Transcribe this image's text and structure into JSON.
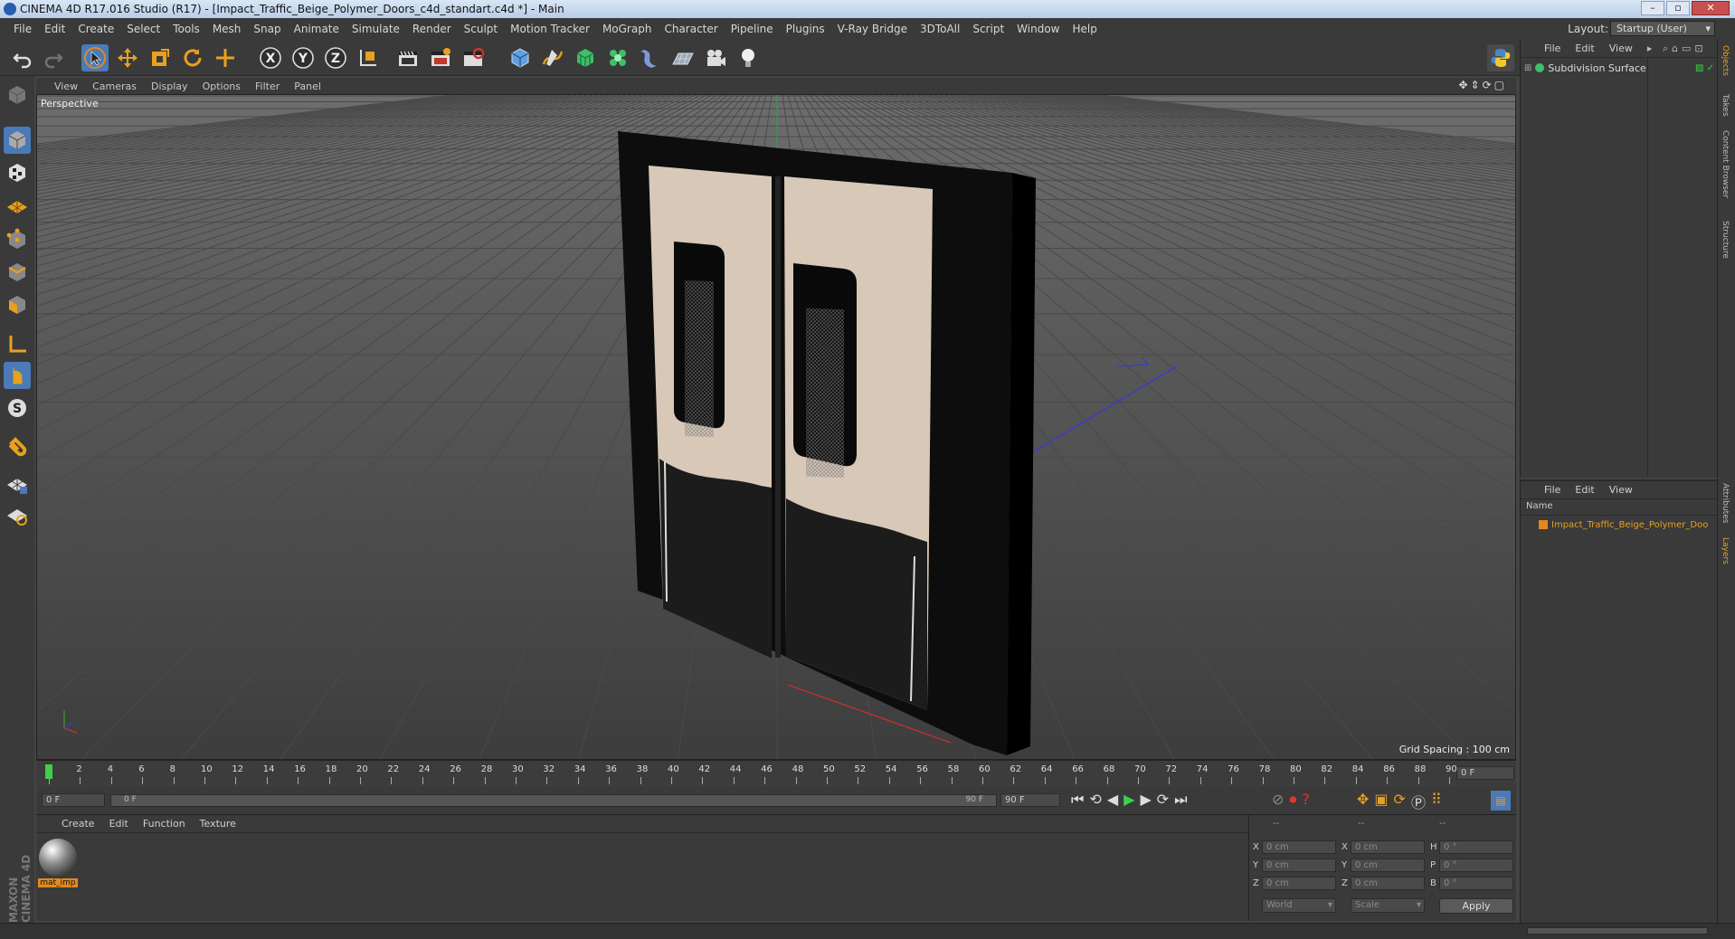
{
  "window": {
    "title": "CINEMA 4D R17.016 Studio (R17) - [Impact_Traffic_Beige_Polymer_Doors_c4d_standart.c4d *] - Main",
    "controls": [
      "–",
      "▫",
      "✕"
    ]
  },
  "menu": [
    "File",
    "Edit",
    "Create",
    "Select",
    "Tools",
    "Mesh",
    "Snap",
    "Animate",
    "Simulate",
    "Render",
    "Sculpt",
    "Motion Tracker",
    "MoGraph",
    "Character",
    "Pipeline",
    "Plugins",
    "V-Ray Bridge",
    "3DToAll",
    "Script",
    "Window",
    "Help"
  ],
  "layout": {
    "label": "Layout:",
    "value": "Startup (User)"
  },
  "toolbar": {
    "icons": [
      "undo-icon",
      "redo-icon",
      "select-arrow-icon",
      "move-icon",
      "scale-icon",
      "rotate-icon",
      "transform-icon",
      "x-axis-icon",
      "y-axis-icon",
      "z-axis-icon",
      "coordinate-system-icon",
      "render-view-icon",
      "render-picture-viewer-icon",
      "render-settings-icon",
      "cube-icon",
      "pen-spline-icon",
      "subdivision-icon",
      "cloner-icon",
      "deformer-icon",
      "floor-icon",
      "camera-icon",
      "light-icon",
      "python-icon"
    ],
    "axis_labels": [
      "X",
      "Y",
      "Z"
    ]
  },
  "left_tools": [
    "make-editable-icon",
    "model-mode-icon",
    "texture-mode-icon",
    "workplane-icon",
    "points-mode-icon",
    "edges-mode-icon",
    "polygons-mode-icon",
    "axis-mode-icon",
    "tweak-mode-icon",
    "solo-icon",
    "magnet-icon",
    "snap-grid-icon",
    "snap-settings-icon"
  ],
  "viewport": {
    "menu": [
      "View",
      "Cameras",
      "Display",
      "Options",
      "Filter",
      "Panel"
    ],
    "label": "Perspective",
    "grid_spacing": "Grid Spacing : 100 cm"
  },
  "timeline": {
    "ticks": [
      "0",
      "2",
      "4",
      "6",
      "8",
      "10",
      "12",
      "14",
      "16",
      "18",
      "20",
      "22",
      "24",
      "26",
      "28",
      "30",
      "32",
      "34",
      "36",
      "38",
      "40",
      "42",
      "44",
      "46",
      "48",
      "50",
      "52",
      "54",
      "56",
      "58",
      "60",
      "62",
      "64",
      "66",
      "68",
      "70",
      "72",
      "74",
      "76",
      "78",
      "80",
      "82",
      "84",
      "86",
      "88",
      "90"
    ],
    "current_frame": "0 F"
  },
  "transport": {
    "start_field": "0 F",
    "range_start": "0 F",
    "range_end": "90 F",
    "end_field": "90 F"
  },
  "material_panel": {
    "menu": [
      "Create",
      "Edit",
      "Function",
      "Texture"
    ],
    "materials": [
      {
        "name": "mat_imp"
      }
    ],
    "brand": "MAXON CINEMA 4D"
  },
  "coordinates": {
    "headers": [
      "--",
      "--",
      "--"
    ],
    "rows": [
      {
        "axis": "X",
        "pos": "0 cm",
        "size_axis": "X",
        "size": "0 cm",
        "rot_axis": "H",
        "rot": "0 °"
      },
      {
        "axis": "Y",
        "pos": "0 cm",
        "size_axis": "Y",
        "size": "0 cm",
        "rot_axis": "P",
        "rot": "0 °"
      },
      {
        "axis": "Z",
        "pos": "0 cm",
        "size_axis": "Z",
        "size": "0 cm",
        "rot_axis": "B",
        "rot": "0 °"
      }
    ],
    "mode_select": "World",
    "size_select": "Scale",
    "apply_label": "Apply"
  },
  "objects_panel": {
    "menu": [
      "File",
      "Edit",
      "View"
    ],
    "items": [
      {
        "name": "Subdivision Surface"
      }
    ]
  },
  "layers_panel": {
    "menu": [
      "File",
      "Edit",
      "View"
    ],
    "column": "Name",
    "items": [
      {
        "name": "Impact_Traffic_Beige_Polymer_Doo"
      }
    ]
  },
  "right_tabs": {
    "top": [
      "Objects",
      "Takes",
      "Content Browser",
      "Structure"
    ],
    "bottom": [
      "Attributes",
      "Layers"
    ]
  },
  "colors": {
    "accent_orange": "#e08a1e",
    "selection_blue": "#4a7ab8",
    "play_green": "#3fd04a"
  }
}
